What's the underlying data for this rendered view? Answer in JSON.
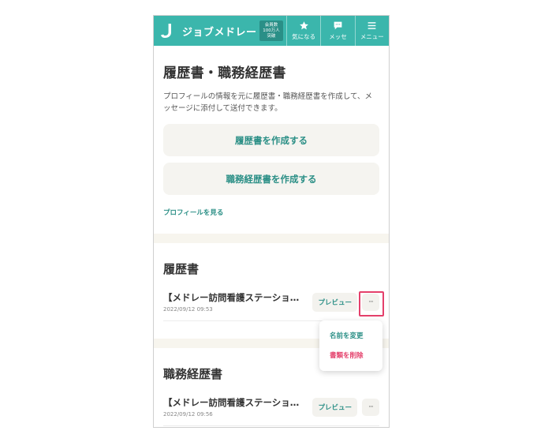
{
  "header": {
    "logo_text": "ジョブメドレー",
    "members_badge": "会員数\n100万人\n突破",
    "nav": [
      {
        "label": "気になる",
        "icon": "star-icon"
      },
      {
        "label": "メッセ",
        "icon": "chat-icon"
      },
      {
        "label": "メニュー",
        "icon": "hamburger-icon"
      }
    ]
  },
  "intro": {
    "title": "履歴書・職務経歴書",
    "description": "プロフィールの情報を元に履歴書・職務経歴書を作成して、メッセージに添付して送付できます。",
    "create_resume_label": "履歴書を作成する",
    "create_cv_label": "職務経歴書を作成する",
    "profile_link": "プロフィールを見る"
  },
  "resume_section": {
    "title": "履歴書",
    "item": {
      "name": "【メドレー訪問看護ステーション】",
      "date": "2022/09/12 09:53",
      "preview_label": "プレビュー",
      "more_label": "···"
    }
  },
  "menu": {
    "rename_label": "名前を変更",
    "delete_label": "書類を削除"
  },
  "cv_section": {
    "title": "職務経歴書",
    "item": {
      "name": "【メドレー訪問看護ステーション】",
      "date": "2022/09/12 09:56",
      "preview_label": "プレビュー",
      "more_label": "···"
    }
  },
  "colors": {
    "brand": "#3bb6ac",
    "accent_text": "#2b8f86",
    "danger": "#e4406b"
  }
}
